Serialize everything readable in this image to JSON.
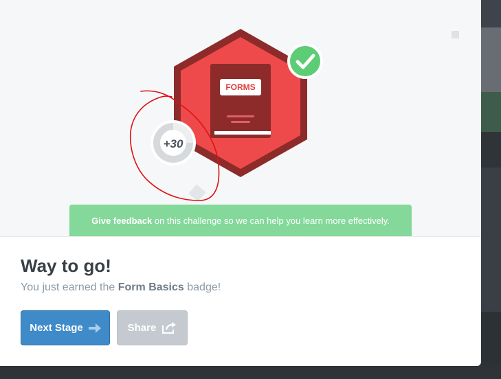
{
  "badge": {
    "book_label": "FORMS",
    "points": "+30"
  },
  "feedback": {
    "link": "Give feedback",
    "text": " on this challenge so we can help you learn more effectively."
  },
  "result": {
    "title": "Way to go!",
    "subtitle_prefix": "You just earned the ",
    "badge_name": "Form Basics",
    "subtitle_suffix": " badge!"
  },
  "actions": {
    "next_label": "Next Stage",
    "share_label": "Share"
  },
  "icons": {
    "check": "checkmark-icon",
    "next": "arrow-right-icon",
    "share": "share-icon"
  },
  "colors": {
    "badge_red": "#ef4a4b",
    "badge_dark": "#8d2b2b",
    "check_green": "#5ccc75",
    "feedback_green": "#84d89a",
    "next_blue": "#3f8bc9",
    "share_gray": "#c5cad0",
    "annotation_red": "#e01010"
  }
}
